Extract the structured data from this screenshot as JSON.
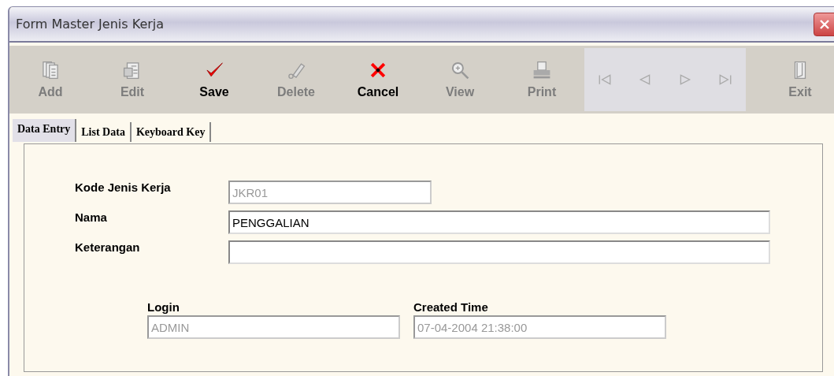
{
  "window": {
    "title": "Form Master Jenis Kerja"
  },
  "toolbar": [
    {
      "label": "Add",
      "kind": "add",
      "disabled": true
    },
    {
      "label": "Edit",
      "kind": "edit",
      "disabled": true
    },
    {
      "label": "Save",
      "kind": "save",
      "disabled": false
    },
    {
      "label": "Delete",
      "kind": "delete",
      "disabled": true
    },
    {
      "label": "Cancel",
      "kind": "cancel",
      "disabled": false
    },
    {
      "label": "View",
      "kind": "view",
      "disabled": true
    },
    {
      "label": "Print",
      "kind": "print",
      "disabled": true
    }
  ],
  "navigation": [
    {
      "kind": "first",
      "disabled": true
    },
    {
      "kind": "previous",
      "disabled": true
    },
    {
      "kind": "next",
      "disabled": true
    },
    {
      "kind": "last",
      "disabled": true
    }
  ],
  "exit": {
    "label": "Exit",
    "disabled": true
  },
  "tabs": [
    {
      "label": "Data Entry",
      "selected": true
    },
    {
      "label": "List Data",
      "selected": false
    },
    {
      "label": "Keyboard Key",
      "selected": false
    }
  ],
  "fields": [
    {
      "label": "Kode Jenis Kerja",
      "value": "JKR01",
      "disabled": true
    },
    {
      "label": "Nama",
      "value": "PENGGALIAN",
      "disabled": false
    },
    {
      "label": "Keterangan",
      "disabled": false
    }
  ],
  "audit": [
    {
      "label": "Login",
      "value": "ADMIN",
      "disabled": true
    },
    {
      "label": "Created Time",
      "value": "07-04-2004 21:38:00",
      "disabled": true
    }
  ]
}
